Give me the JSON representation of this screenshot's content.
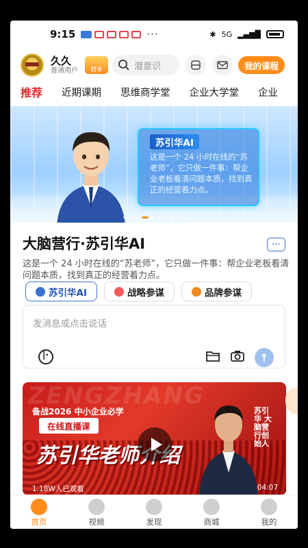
{
  "status_bar": {
    "time": "9:15",
    "network": "5G",
    "more": "···"
  },
  "header": {
    "username": "久久",
    "user_level": "普通用户",
    "badge_label": "打卡",
    "search_placeholder": "潜意识",
    "my_courses_label": "我的课程"
  },
  "tabs": [
    {
      "label": "推荐",
      "active": true
    },
    {
      "label": "近期课期"
    },
    {
      "label": "思维商学堂"
    },
    {
      "label": "企业大学堂"
    },
    {
      "label": "企业"
    }
  ],
  "banner": {
    "card_title": "苏引华AI",
    "card_text": "这是一个 24 小时在线的“苏老师”，它只做一件事：帮企业老板看清问题本质，找到真正的经营着力点。"
  },
  "ai_section": {
    "title": "大脑营行·苏引华AI",
    "description": "这是一个 24 小时在线的“苏老师”，它只做一件事：帮企业老板看清问题本质，找到真正的经营着力点。",
    "chips": [
      {
        "label": "苏引华AI",
        "color": "#3b6fd6",
        "active": true
      },
      {
        "label": "战略参谋",
        "color": "#f45a5a"
      },
      {
        "label": "品牌参谋",
        "color": "#f08a1e"
      }
    ],
    "input_placeholder": "发消息或点击说话"
  },
  "video": {
    "bg_text": "ZENGZHANG",
    "subtitle": "备战2026 中小企业必学",
    "live_label": "在线直播课",
    "headline": "苏引华老师介绍",
    "tag": "苏引华 大脑营行创始人",
    "views": "1.18W人已观看",
    "duration": "04:07"
  },
  "bottom_nav": [
    {
      "label": "首页",
      "active": true
    },
    {
      "label": "视频"
    },
    {
      "label": "发现"
    },
    {
      "label": "商城"
    },
    {
      "label": "我的"
    }
  ],
  "colors": {
    "accent": "#ff8c1a",
    "tab_active": "#e8252a",
    "ai_blue": "#3b6fd6"
  }
}
